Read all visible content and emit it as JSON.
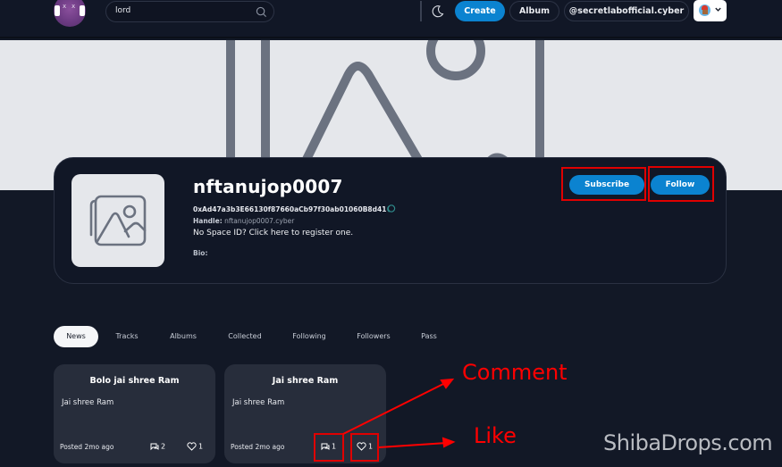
{
  "topbar": {
    "logo_icon": "headphones-avatar-logo",
    "search": {
      "value": "lord",
      "icon": "search-icon"
    },
    "theme_icon": "moon-icon",
    "create_label": "Create",
    "album_label": "Album",
    "handle_label": "@secretlabofficial.cyber",
    "account_icon": "account-avatar",
    "chevron_icon": "chevron-down-icon"
  },
  "banner": {
    "icon": "image-placeholder-icon"
  },
  "profile": {
    "name": "nftanujop0007",
    "address": "0xAd47a3b3E66130f87660aCb97f30ab01060B8d41",
    "handle_label": "Handle:",
    "handle_value": "nftanujop0007.cyber",
    "space_id_text": "No Space ID? Click here to register one.",
    "bio_label": "Bio:",
    "subscribe_label": "Subscribe",
    "follow_label": "Follow"
  },
  "tabs": [
    {
      "label": "News",
      "active": true
    },
    {
      "label": "Tracks"
    },
    {
      "label": "Albums"
    },
    {
      "label": "Collected"
    },
    {
      "label": "Following"
    },
    {
      "label": "Followers"
    },
    {
      "label": "Pass"
    }
  ],
  "posts": [
    {
      "title": "Bolo jai shree Ram",
      "body": "Jai shree Ram",
      "posted": "Posted 2mo ago",
      "comments": "2",
      "likes": "1"
    },
    {
      "title": "Jai shree Ram",
      "body": "Jai shree Ram",
      "posted": "Posted 2mo ago",
      "comments": "1",
      "likes": "1"
    }
  ],
  "annotations": {
    "comment": "Comment",
    "like": "Like",
    "color": "#ff0000"
  },
  "watermark": "ShibaDrops.com",
  "colors": {
    "accent": "#0b83d0",
    "background": "#121826",
    "card": "#272d3b"
  }
}
